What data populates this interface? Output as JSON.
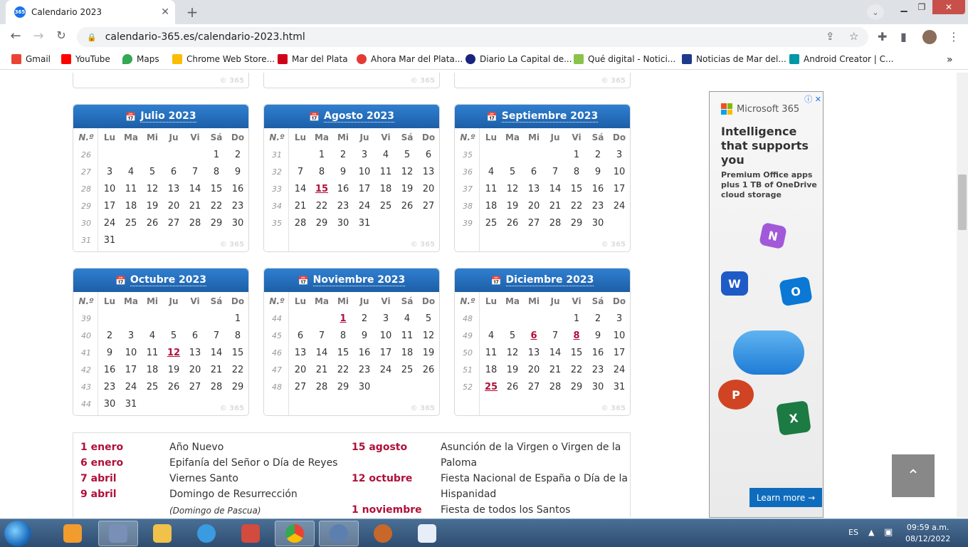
{
  "browser": {
    "tab_title": "Calendario 2023",
    "tab_favicon": "365",
    "url": "calendario-365.es/calendario-2023.html",
    "bookmarks": [
      "Gmail",
      "YouTube",
      "Maps",
      "Chrome Web Store...",
      "Mar del Plata",
      "Ahora Mar del Plata...",
      "Diario La Capital de...",
      "Qué digital - Notici...",
      "Noticias de Mar del...",
      "Android Creator | C..."
    ]
  },
  "calendar": {
    "weekday_headers": [
      "N.º",
      "Lu",
      "Ma",
      "Mi",
      "Ju",
      "Vi",
      "Sá",
      "Do"
    ],
    "watermark": "© 365",
    "months": [
      {
        "title": "Julio 2023",
        "rows": [
          [
            "26",
            "",
            "",
            "",
            "",
            "",
            "1",
            "2"
          ],
          [
            "27",
            "3",
            "4",
            "5",
            "6",
            "7",
            "8",
            "9"
          ],
          [
            "28",
            "10",
            "11",
            "12",
            "13",
            "14",
            "15",
            "16"
          ],
          [
            "29",
            "17",
            "18",
            "19",
            "20",
            "21",
            "22",
            "23"
          ],
          [
            "30",
            "24",
            "25",
            "26",
            "27",
            "28",
            "29",
            "30"
          ],
          [
            "31",
            "31",
            "",
            "",
            "",
            "",
            "",
            ""
          ]
        ]
      },
      {
        "title": "Agosto 2023",
        "rows": [
          [
            "31",
            "",
            "1",
            "2",
            "3",
            "4",
            "5",
            "6"
          ],
          [
            "32",
            "7",
            "8",
            "9",
            "10",
            "11",
            "12",
            "13"
          ],
          [
            "33",
            "14",
            "15",
            "16",
            "17",
            "18",
            "19",
            "20"
          ],
          [
            "34",
            "21",
            "22",
            "23",
            "24",
            "25",
            "26",
            "27"
          ],
          [
            "35",
            "28",
            "29",
            "30",
            "31",
            "",
            "",
            ""
          ]
        ]
      },
      {
        "title": "Septiembre 2023",
        "rows": [
          [
            "35",
            "",
            "",
            "",
            "",
            "1",
            "2",
            "3"
          ],
          [
            "36",
            "4",
            "5",
            "6",
            "7",
            "8",
            "9",
            "10"
          ],
          [
            "37",
            "11",
            "12",
            "13",
            "14",
            "15",
            "16",
            "17"
          ],
          [
            "38",
            "18",
            "19",
            "20",
            "21",
            "22",
            "23",
            "24"
          ],
          [
            "39",
            "25",
            "26",
            "27",
            "28",
            "29",
            "30",
            ""
          ]
        ]
      },
      {
        "title": "Octubre 2023",
        "rows": [
          [
            "39",
            "",
            "",
            "",
            "",
            "",
            "",
            "1"
          ],
          [
            "40",
            "2",
            "3",
            "4",
            "5",
            "6",
            "7",
            "8"
          ],
          [
            "41",
            "9",
            "10",
            "11",
            "12",
            "13",
            "14",
            "15"
          ],
          [
            "42",
            "16",
            "17",
            "18",
            "19",
            "20",
            "21",
            "22"
          ],
          [
            "43",
            "23",
            "24",
            "25",
            "26",
            "27",
            "28",
            "29"
          ],
          [
            "44",
            "30",
            "31",
            "",
            "",
            "",
            "",
            ""
          ]
        ]
      },
      {
        "title": "Noviembre 2023",
        "rows": [
          [
            "44",
            "",
            "",
            "1",
            "2",
            "3",
            "4",
            "5"
          ],
          [
            "45",
            "6",
            "7",
            "8",
            "9",
            "10",
            "11",
            "12"
          ],
          [
            "46",
            "13",
            "14",
            "15",
            "16",
            "17",
            "18",
            "19"
          ],
          [
            "47",
            "20",
            "21",
            "22",
            "23",
            "24",
            "25",
            "26"
          ],
          [
            "48",
            "27",
            "28",
            "29",
            "30",
            "",
            "",
            ""
          ]
        ]
      },
      {
        "title": "Diciembre 2023",
        "rows": [
          [
            "48",
            "",
            "",
            "",
            "",
            "1",
            "2",
            "3"
          ],
          [
            "49",
            "4",
            "5",
            "6",
            "7",
            "8",
            "9",
            "10"
          ],
          [
            "50",
            "11",
            "12",
            "13",
            "14",
            "15",
            "16",
            "17"
          ],
          [
            "51",
            "18",
            "19",
            "20",
            "21",
            "22",
            "23",
            "24"
          ],
          [
            "52",
            "25",
            "26",
            "27",
            "28",
            "29",
            "30",
            "31"
          ]
        ]
      }
    ],
    "highlighted": {
      "Agosto 2023": [
        "15"
      ],
      "Octubre 2023": [
        "12"
      ],
      "Noviembre 2023": [
        "1"
      ],
      "Diciembre 2023": [
        "6",
        "8",
        "25"
      ]
    }
  },
  "holidays": {
    "left": [
      {
        "date": "1 enero",
        "name": "Año Nuevo"
      },
      {
        "date": "6 enero",
        "name": "Epifanía del Señor o Día de Reyes"
      },
      {
        "date": "7 abril",
        "name": "Viernes Santo"
      },
      {
        "date": "9 abril",
        "name": "Domingo de Resurrección"
      }
    ],
    "left_note": "(Domingo de Pascua)",
    "right": [
      {
        "date": "15 agosto",
        "name": "Asunción de la Virgen o Virgen de la",
        "name2": "Paloma"
      },
      {
        "date": "12 octubre",
        "name": "Fiesta Nacional de España o Día de la",
        "name2": "Hispanidad"
      },
      {
        "date": "1 noviembre",
        "name": "Fiesta de todos los Santos"
      }
    ]
  },
  "ad": {
    "brand": "Microsoft 365",
    "headline": "Intelligence that supports you",
    "body": "Premium Office apps plus 1 TB of OneDrive cloud storage",
    "cta": "Learn more →"
  },
  "taskbar": {
    "lang": "ES",
    "time": "09:59 a.m.",
    "date": "08/12/2022"
  }
}
